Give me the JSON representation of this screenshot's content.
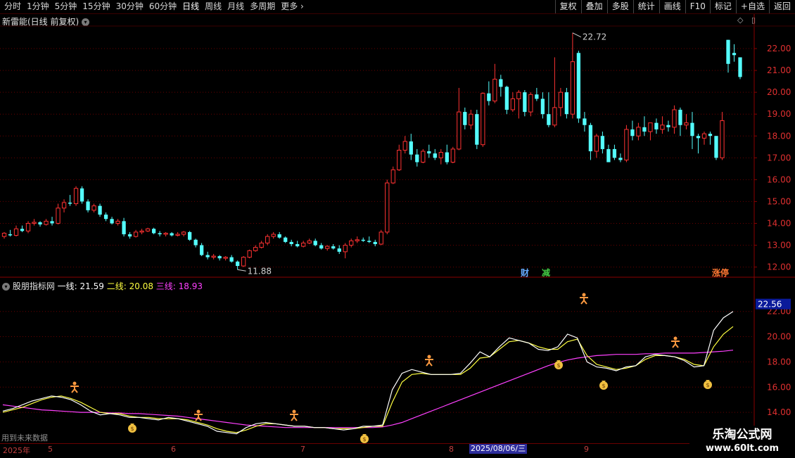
{
  "toolbar": {
    "periods": [
      "分时",
      "1分钟",
      "5分钟",
      "15分钟",
      "30分钟",
      "60分钟",
      "日线",
      "周线",
      "月线",
      "多周期",
      "更多"
    ],
    "active_period": "日线",
    "more_arrow": "›",
    "tools": [
      "复权",
      "叠加",
      "多股",
      "统计",
      "画线",
      "F10",
      "标记",
      "+自选",
      "返回"
    ]
  },
  "main_chart": {
    "title": "新雷能(日线 前复权)",
    "title_icon": "chevron-down-icon",
    "right_icons": [
      "◇",
      "▯"
    ],
    "high_label": "22.72",
    "low_label": "11.88",
    "y_ticks": [
      "22.00",
      "21.00",
      "20.00",
      "19.00",
      "18.00",
      "17.00",
      "16.00",
      "15.00",
      "14.00",
      "13.00",
      "12.00"
    ],
    "markers": [
      {
        "text": "财",
        "color": "#66aaff"
      },
      {
        "text": "减",
        "color": "#44cc44"
      },
      {
        "text": "涨停",
        "color": "#ff7733"
      }
    ],
    "colors": {
      "up": "#ff3232",
      "down": "#54ffff",
      "grid": "#6a0000"
    }
  },
  "indicator": {
    "name": "股朋指标网",
    "line1_label": "一线:",
    "line1_value": "21.59",
    "line2_label": "二线:",
    "line2_value": "20.08",
    "line3_label": "三线:",
    "line3_value": "18.93",
    "current_value": "22.56",
    "y_ticks": [
      "22.00",
      "20.00",
      "18.00",
      "16.00",
      "14.00"
    ],
    "colors": {
      "line1": "#ffffff",
      "line2": "#ffff40",
      "line3": "#ff40ff"
    }
  },
  "footer": {
    "future_note": "用到未来数据",
    "year_label": "2025年",
    "month_labels": [
      "5",
      "6",
      "7",
      "8",
      "9"
    ],
    "cursor_date": "2025/08/06/三"
  },
  "brand": {
    "line1": "乐淘公式网",
    "line2": "www.60lt.com"
  },
  "chart_data": {
    "type": "candlestick",
    "title": "新雷能(日线 前复权)",
    "ylim": [
      11.6,
      23.0
    ],
    "candles": [
      [
        13.4,
        13.6,
        13.3,
        13.55
      ],
      [
        13.5,
        13.7,
        13.4,
        13.45
      ],
      [
        13.45,
        13.9,
        13.4,
        13.75
      ],
      [
        13.75,
        13.9,
        13.6,
        13.65
      ],
      [
        13.65,
        14.1,
        13.55,
        14.0
      ],
      [
        14.0,
        14.2,
        13.9,
        14.05
      ],
      [
        14.05,
        14.1,
        13.85,
        13.95
      ],
      [
        13.95,
        14.2,
        13.9,
        14.1
      ],
      [
        14.1,
        14.3,
        13.9,
        14.0
      ],
      [
        14.0,
        14.9,
        13.95,
        14.7
      ],
      [
        14.7,
        15.1,
        14.5,
        14.95
      ],
      [
        14.95,
        15.3,
        14.8,
        14.9
      ],
      [
        14.9,
        15.7,
        14.8,
        15.6
      ],
      [
        15.6,
        15.7,
        14.9,
        15.0
      ],
      [
        15.0,
        15.1,
        14.5,
        14.6
      ],
      [
        14.6,
        14.9,
        14.5,
        14.8
      ],
      [
        14.8,
        14.9,
        14.3,
        14.4
      ],
      [
        14.4,
        14.5,
        14.1,
        14.2
      ],
      [
        14.2,
        14.3,
        13.95,
        14.0
      ],
      [
        14.0,
        14.2,
        13.9,
        14.1
      ],
      [
        14.1,
        14.25,
        13.4,
        13.5
      ],
      [
        13.5,
        13.6,
        13.3,
        13.4
      ],
      [
        13.4,
        13.7,
        13.35,
        13.6
      ],
      [
        13.6,
        13.75,
        13.5,
        13.65
      ],
      [
        13.65,
        13.8,
        13.6,
        13.75
      ],
      [
        13.75,
        13.8,
        13.5,
        13.55
      ],
      [
        13.55,
        13.65,
        13.4,
        13.5
      ],
      [
        13.5,
        13.6,
        13.4,
        13.55
      ],
      [
        13.55,
        13.6,
        13.4,
        13.45
      ],
      [
        13.45,
        13.6,
        13.4,
        13.5
      ],
      [
        13.5,
        13.65,
        13.4,
        13.6
      ],
      [
        13.6,
        13.65,
        13.2,
        13.25
      ],
      [
        13.25,
        13.3,
        12.9,
        13.0
      ],
      [
        13.0,
        13.1,
        12.5,
        12.55
      ],
      [
        12.55,
        12.7,
        12.35,
        12.45
      ],
      [
        12.45,
        12.6,
        12.35,
        12.5
      ],
      [
        12.5,
        12.55,
        12.3,
        12.4
      ],
      [
        12.4,
        12.5,
        12.3,
        12.45
      ],
      [
        12.45,
        12.55,
        12.2,
        12.25
      ],
      [
        12.25,
        12.3,
        11.88,
        12.05
      ],
      [
        12.05,
        12.5,
        12.0,
        12.45
      ],
      [
        12.45,
        12.8,
        12.4,
        12.75
      ],
      [
        12.75,
        13.0,
        12.7,
        12.9
      ],
      [
        12.9,
        13.2,
        12.85,
        13.1
      ],
      [
        13.1,
        13.5,
        13.0,
        13.4
      ],
      [
        13.4,
        13.6,
        13.3,
        13.5
      ],
      [
        13.5,
        13.6,
        13.3,
        13.35
      ],
      [
        13.35,
        13.4,
        13.1,
        13.15
      ],
      [
        13.15,
        13.25,
        12.95,
        13.05
      ],
      [
        13.05,
        13.2,
        12.9,
        12.95
      ],
      [
        12.95,
        13.2,
        12.9,
        13.1
      ],
      [
        13.1,
        13.3,
        13.05,
        13.2
      ],
      [
        13.2,
        13.3,
        12.95,
        13.0
      ],
      [
        13.0,
        13.1,
        12.8,
        12.85
      ],
      [
        12.85,
        13.0,
        12.75,
        12.95
      ],
      [
        12.95,
        13.05,
        12.8,
        12.85
      ],
      [
        12.85,
        13.0,
        12.6,
        12.7
      ],
      [
        12.7,
        13.1,
        12.4,
        13.0
      ],
      [
        13.0,
        13.3,
        12.9,
        13.2
      ],
      [
        13.2,
        13.4,
        13.1,
        13.25
      ],
      [
        13.25,
        13.35,
        13.15,
        13.2
      ],
      [
        13.2,
        13.4,
        13.1,
        13.15
      ],
      [
        13.15,
        13.25,
        12.95,
        13.05
      ],
      [
        13.05,
        13.7,
        13.0,
        13.6
      ],
      [
        13.6,
        16.0,
        13.5,
        15.85
      ],
      [
        15.85,
        16.6,
        15.8,
        16.45
      ],
      [
        16.45,
        17.6,
        16.4,
        17.35
      ],
      [
        17.35,
        18.0,
        17.2,
        17.75
      ],
      [
        17.75,
        18.1,
        16.9,
        17.15
      ],
      [
        17.15,
        17.4,
        16.6,
        16.8
      ],
      [
        16.8,
        17.4,
        16.75,
        17.3
      ],
      [
        17.3,
        17.6,
        17.0,
        17.2
      ],
      [
        17.2,
        17.4,
        16.9,
        17.0
      ],
      [
        17.0,
        17.4,
        16.7,
        17.25
      ],
      [
        17.25,
        17.6,
        16.7,
        16.8
      ],
      [
        16.8,
        17.5,
        16.75,
        17.4
      ],
      [
        17.4,
        20.2,
        17.35,
        19.1
      ],
      [
        19.1,
        19.3,
        18.3,
        18.5
      ],
      [
        18.5,
        19.2,
        18.3,
        19.0
      ],
      [
        19.0,
        19.2,
        17.4,
        17.6
      ],
      [
        17.6,
        20.0,
        17.5,
        19.95
      ],
      [
        19.95,
        20.5,
        19.4,
        19.6
      ],
      [
        19.6,
        21.3,
        19.5,
        20.6
      ],
      [
        20.6,
        20.8,
        19.8,
        20.25
      ],
      [
        20.25,
        20.3,
        19.0,
        19.2
      ],
      [
        19.2,
        20.0,
        19.1,
        19.7
      ],
      [
        19.7,
        20.1,
        18.8,
        20.0
      ],
      [
        20.0,
        20.1,
        18.9,
        19.1
      ],
      [
        19.1,
        20.0,
        18.9,
        19.9
      ],
      [
        19.9,
        20.2,
        19.6,
        19.7
      ],
      [
        19.7,
        20.0,
        18.8,
        19.0
      ],
      [
        19.0,
        20.0,
        18.4,
        18.5
      ],
      [
        18.5,
        21.6,
        18.4,
        19.3
      ],
      [
        19.3,
        20.2,
        18.9,
        20.0
      ],
      [
        20.0,
        20.2,
        18.8,
        19.0
      ],
      [
        19.0,
        22.72,
        18.8,
        21.4
      ],
      [
        21.8,
        21.9,
        18.6,
        18.8
      ],
      [
        18.8,
        19.1,
        18.2,
        18.5
      ],
      [
        18.5,
        18.6,
        16.9,
        17.3
      ],
      [
        17.3,
        18.1,
        17.0,
        18.0
      ],
      [
        18.0,
        18.2,
        17.2,
        17.4
      ],
      [
        17.4,
        17.6,
        16.9,
        16.8
      ],
      [
        17.4,
        17.6,
        16.9,
        17.0
      ],
      [
        17.0,
        17.2,
        16.8,
        16.9
      ],
      [
        16.9,
        18.5,
        16.8,
        18.3
      ],
      [
        18.3,
        18.7,
        17.8,
        18.0
      ],
      [
        18.0,
        18.6,
        17.8,
        18.4
      ],
      [
        18.4,
        18.9,
        18.0,
        18.2
      ],
      [
        18.2,
        18.5,
        17.8,
        18.6
      ],
      [
        18.6,
        18.8,
        18.1,
        18.3
      ],
      [
        18.3,
        18.9,
        18.1,
        18.5
      ],
      [
        18.5,
        18.7,
        18.2,
        18.4
      ],
      [
        18.4,
        19.4,
        18.1,
        19.2
      ],
      [
        19.2,
        19.3,
        18.0,
        18.5
      ],
      [
        18.5,
        19.0,
        18.3,
        18.6
      ],
      [
        18.6,
        19.1,
        17.4,
        18.0
      ],
      [
        18.0,
        18.1,
        17.2,
        17.9
      ],
      [
        17.9,
        18.2,
        17.6,
        18.1
      ],
      [
        18.1,
        18.2,
        17.6,
        18.0
      ],
      [
        18.0,
        18.0,
        16.9,
        17.0
      ],
      [
        17.0,
        19.1,
        16.9,
        18.7
      ],
      [
        22.4,
        22.4,
        20.9,
        21.3
      ],
      [
        21.8,
        22.2,
        21.4,
        21.7
      ],
      [
        21.6,
        21.6,
        20.6,
        20.7
      ]
    ],
    "indicator_series": [
      {
        "name": "一线",
        "values": [
          14.1,
          14.3,
          14.6,
          14.9,
          15.1,
          15.3,
          15.2,
          15.0,
          14.6,
          14.1,
          13.8,
          13.9,
          13.8,
          13.6,
          13.6,
          13.5,
          13.4,
          13.6,
          13.5,
          13.3,
          13.1,
          12.9,
          12.5,
          12.4,
          12.3,
          12.8,
          13.1,
          13.2,
          13.1,
          13.0,
          12.9,
          12.9,
          12.8,
          12.8,
          12.7,
          12.6,
          12.7,
          12.9,
          12.9,
          13.0,
          15.8,
          17.1,
          17.4,
          17.2,
          17.0,
          17.0,
          17.0,
          17.1,
          17.9,
          18.8,
          18.4,
          19.2,
          19.9,
          19.7,
          19.5,
          19.0,
          18.9,
          19.2,
          20.2,
          19.9,
          18.0,
          17.6,
          17.5,
          17.3,
          17.6,
          17.7,
          18.4,
          18.6,
          18.5,
          18.4,
          18.1,
          17.6,
          17.7,
          20.5,
          21.5,
          22.0
        ]
      },
      {
        "name": "二线",
        "values": [
          14.0,
          14.2,
          14.4,
          14.7,
          15.0,
          15.2,
          15.3,
          15.1,
          14.8,
          14.4,
          14.0,
          13.9,
          13.9,
          13.7,
          13.6,
          13.6,
          13.5,
          13.5,
          13.5,
          13.4,
          13.2,
          13.0,
          12.7,
          12.5,
          12.4,
          12.6,
          12.9,
          13.1,
          13.1,
          13.0,
          12.9,
          12.9,
          12.8,
          12.8,
          12.7,
          12.7,
          12.7,
          12.8,
          12.9,
          12.9,
          14.8,
          16.4,
          17.0,
          17.1,
          17.0,
          17.0,
          17.0,
          17.0,
          17.5,
          18.3,
          18.4,
          19.0,
          19.6,
          19.7,
          19.5,
          19.2,
          19.0,
          19.0,
          19.6,
          19.8,
          18.5,
          17.8,
          17.6,
          17.4,
          17.5,
          17.7,
          18.2,
          18.5,
          18.5,
          18.4,
          18.2,
          17.8,
          17.7,
          19.2,
          20.2,
          20.8
        ]
      },
      {
        "name": "三线",
        "values": [
          14.6,
          14.5,
          14.4,
          14.3,
          14.2,
          14.15,
          14.1,
          14.05,
          14.0,
          14.0,
          14.0,
          13.95,
          13.95,
          13.9,
          13.9,
          13.85,
          13.8,
          13.75,
          13.7,
          13.6,
          13.5,
          13.4,
          13.3,
          13.2,
          13.1,
          13.0,
          12.95,
          12.9,
          12.85,
          12.8,
          12.8,
          12.8,
          12.8,
          12.8,
          12.8,
          12.8,
          12.8,
          12.8,
          12.8,
          12.85,
          13.0,
          13.2,
          13.5,
          13.8,
          14.1,
          14.4,
          14.7,
          15.0,
          15.3,
          15.6,
          15.9,
          16.2,
          16.5,
          16.8,
          17.1,
          17.4,
          17.7,
          17.95,
          18.15,
          18.3,
          18.4,
          18.5,
          18.55,
          18.6,
          18.6,
          18.6,
          18.65,
          18.65,
          18.7,
          18.7,
          18.7,
          18.7,
          18.75,
          18.8,
          18.85,
          18.93
        ]
      }
    ],
    "indicator_ylim": [
      12.0,
      23.6
    ]
  }
}
